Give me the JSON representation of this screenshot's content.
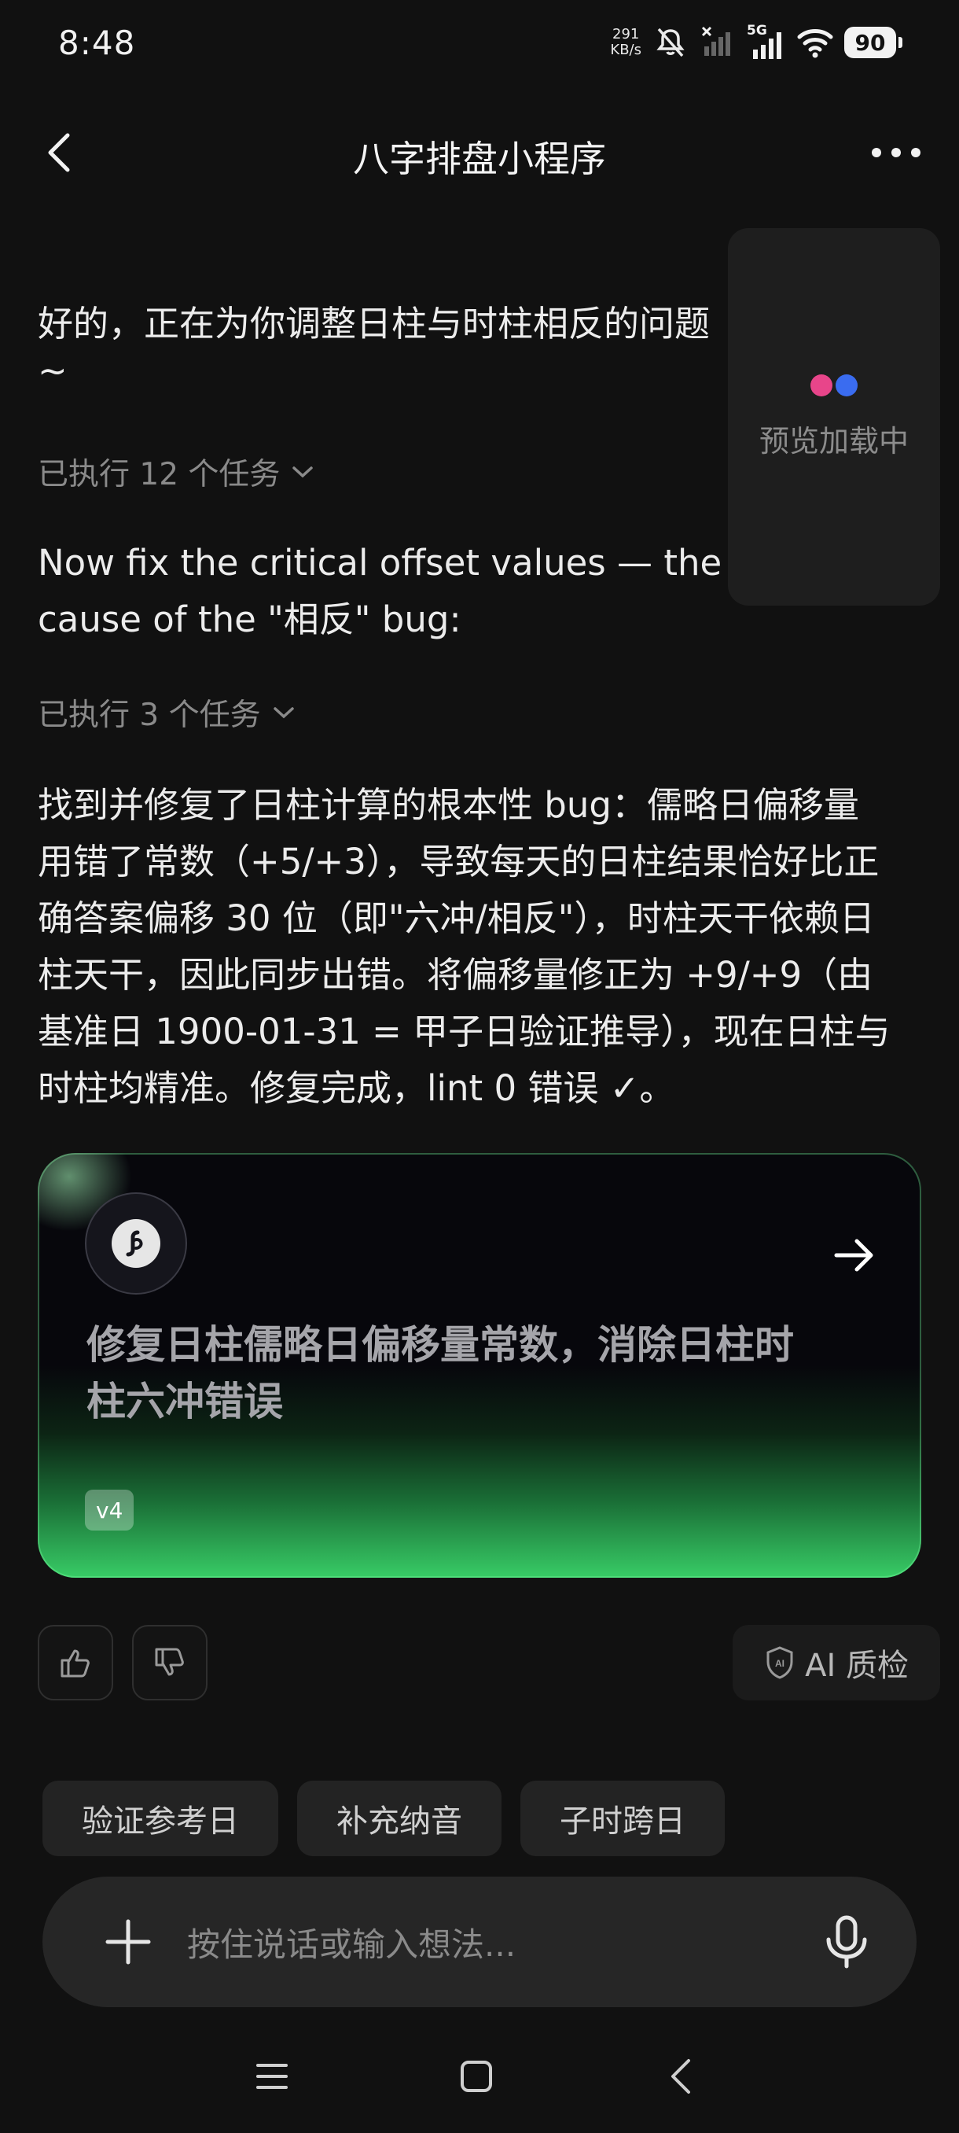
{
  "status_bar": {
    "time": "8:48",
    "net_speed_value": "291",
    "net_speed_unit": "KB/s",
    "network_type": "5G",
    "battery": "90"
  },
  "header": {
    "title": "八字排盘小程序"
  },
  "messages": {
    "intro_line1": "好的，正在为你调整日柱与时柱相反的问题",
    "intro_line2": "~",
    "tasks1_label": "已执行 12 个任务",
    "fix_line1": "Now fix the critical offset values — the",
    "fix_line2": "cause of the \"相反\" bug:",
    "tasks2_label": "已执行 3 个任务",
    "summary_lines": [
      "找到并修复了日柱计算的根本性 bug：儒略日偏移量",
      "用错了常数（+5/+3），导致每天的日柱结果恰好比正",
      "确答案偏移 30 位（即\"六冲/相反\"），时柱天干依赖日",
      "柱天干，因此同步出错。将偏移量修正为 +9/+9（由",
      "基准日 1900-01-31 = 甲子日验证推导），现在日柱与",
      "时柱均精准。修复完成，lint 0 错误 ✓。"
    ]
  },
  "preview": {
    "label": "预览加载中",
    "dot_colors": [
      "#e8458a",
      "#3a6cf0"
    ]
  },
  "version_card": {
    "title_line1": "修复日柱儒略日偏移量常数，消除日柱时",
    "title_line2": "柱六冲错误",
    "badge": "v4",
    "accent_color": "#38cc66"
  },
  "feedback": {
    "qc_label": "AI 质检",
    "qc_icon_text": "AI"
  },
  "suggestions": [
    "验证参考日",
    "补充纳音",
    "子时跨日"
  ],
  "input": {
    "placeholder": "按住说话或输入想法..."
  }
}
